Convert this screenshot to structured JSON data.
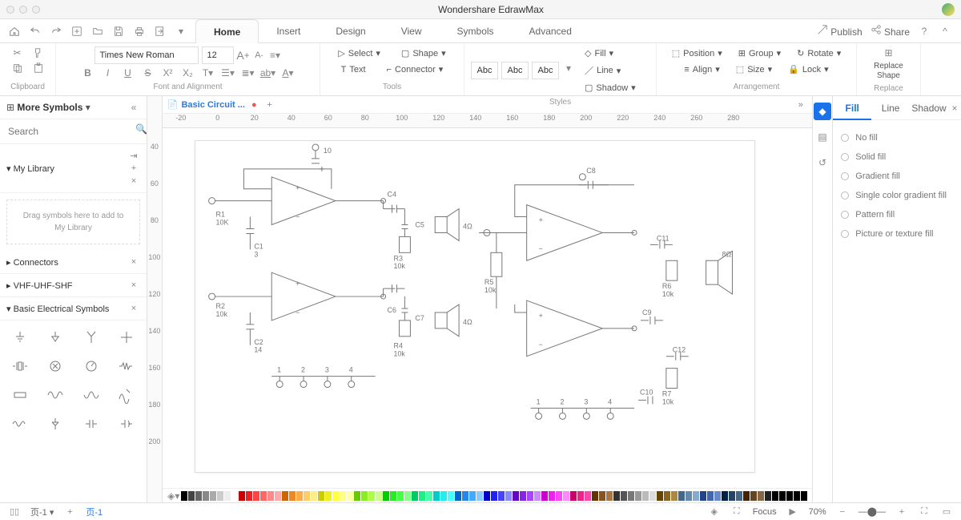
{
  "app": {
    "title": "Wondershare EdrawMax"
  },
  "menubar": {
    "tabs": [
      "Home",
      "Insert",
      "Design",
      "View",
      "Symbols",
      "Advanced"
    ],
    "active": "Home",
    "publish": "Publish",
    "share": "Share"
  },
  "ribbon": {
    "font": {
      "family": "Times New Roman",
      "size": "12"
    },
    "tools": {
      "select": "Select",
      "shape": "Shape",
      "text": "Text",
      "connector": "Connector"
    },
    "styles": {
      "abc1": "Abc",
      "abc2": "Abc",
      "abc3": "Abc",
      "fill": "Fill",
      "line": "Line",
      "shadow": "Shadow"
    },
    "arrange": {
      "position": "Position",
      "group": "Group",
      "rotate": "Rotate",
      "align": "Align",
      "size": "Size",
      "lock": "Lock"
    },
    "replace": {
      "label": "Replace\nShape"
    },
    "labels": {
      "clipboard": "Clipboard",
      "font": "Font and Alignment",
      "tools": "Tools",
      "styles": "Styles",
      "arrangement": "Arrangement",
      "replace": "Replace"
    }
  },
  "sidebar": {
    "more": "More Symbols",
    "search_ph": "Search",
    "lib": "My Library",
    "drop": "Drag symbols here to add to My Library",
    "sections": {
      "connectors": "Connectors",
      "vhf": "VHF-UHF-SHF",
      "elec": "Basic Electrical Symbols"
    }
  },
  "doc": {
    "tab": "Basic Circuit ..."
  },
  "ruler_h": [
    "-20",
    "0",
    "20",
    "40",
    "60",
    "80",
    "100",
    "120",
    "140",
    "160",
    "180",
    "200",
    "220",
    "240",
    "260",
    "280"
  ],
  "ruler_v": [
    "40",
    "60",
    "80",
    "100",
    "120",
    "140",
    "160",
    "180",
    "200"
  ],
  "circuit": {
    "labels": [
      "10",
      "R1",
      "10K",
      "C1",
      "3",
      "R2",
      "10k",
      "C2",
      "14",
      "C4",
      "C5",
      "R3",
      "10k",
      "4Ω",
      "C6",
      "C7",
      "R4",
      "10k",
      "4Ω",
      "1",
      "2",
      "3",
      "4",
      "R5",
      "10k",
      "C8",
      "C11",
      "R6",
      "10k",
      "8Ω",
      "C9",
      "C12",
      "R7",
      "10k",
      "C10",
      "1",
      "2",
      "3",
      "4"
    ]
  },
  "rpanel": {
    "tabs": [
      "Fill",
      "Line",
      "Shadow"
    ],
    "active": "Fill",
    "opts": [
      "No fill",
      "Solid fill",
      "Gradient fill",
      "Single color gradient fill",
      "Pattern fill",
      "Picture or texture fill"
    ]
  },
  "status": {
    "page": "页-1",
    "page2": "页-1",
    "focus": "Focus",
    "zoom": "70%"
  },
  "colors": [
    "#000",
    "#444",
    "#666",
    "#888",
    "#aaa",
    "#ccc",
    "#eee",
    "#fff",
    "#c00",
    "#e22",
    "#f44",
    "#f66",
    "#f88",
    "#faa",
    "#c60",
    "#e82",
    "#fa4",
    "#fc6",
    "#fe8",
    "#cc0",
    "#ee2",
    "#ff4",
    "#ff8",
    "#ffa",
    "#6c0",
    "#8e2",
    "#af4",
    "#cf8",
    "#0c0",
    "#2e2",
    "#4f4",
    "#8f8",
    "#0c6",
    "#2e8",
    "#4fa",
    "#0cc",
    "#2ee",
    "#4ff",
    "#06c",
    "#28e",
    "#4af",
    "#8cf",
    "#00c",
    "#22e",
    "#44f",
    "#88f",
    "#60c",
    "#82e",
    "#a4f",
    "#c8f",
    "#c0c",
    "#e2e",
    "#f4f",
    "#f8f",
    "#c06",
    "#e28",
    "#f4a",
    "#630",
    "#852",
    "#a74",
    "#333",
    "#555",
    "#777",
    "#999",
    "#bbb",
    "#ddd",
    "#640",
    "#862",
    "#a84",
    "#468",
    "#68a",
    "#8ac",
    "#248",
    "#46a",
    "#68c",
    "#024",
    "#246",
    "#468",
    "#420",
    "#642",
    "#864",
    "#222",
    "#000",
    "#000",
    "#000",
    "#000",
    "#000"
  ]
}
